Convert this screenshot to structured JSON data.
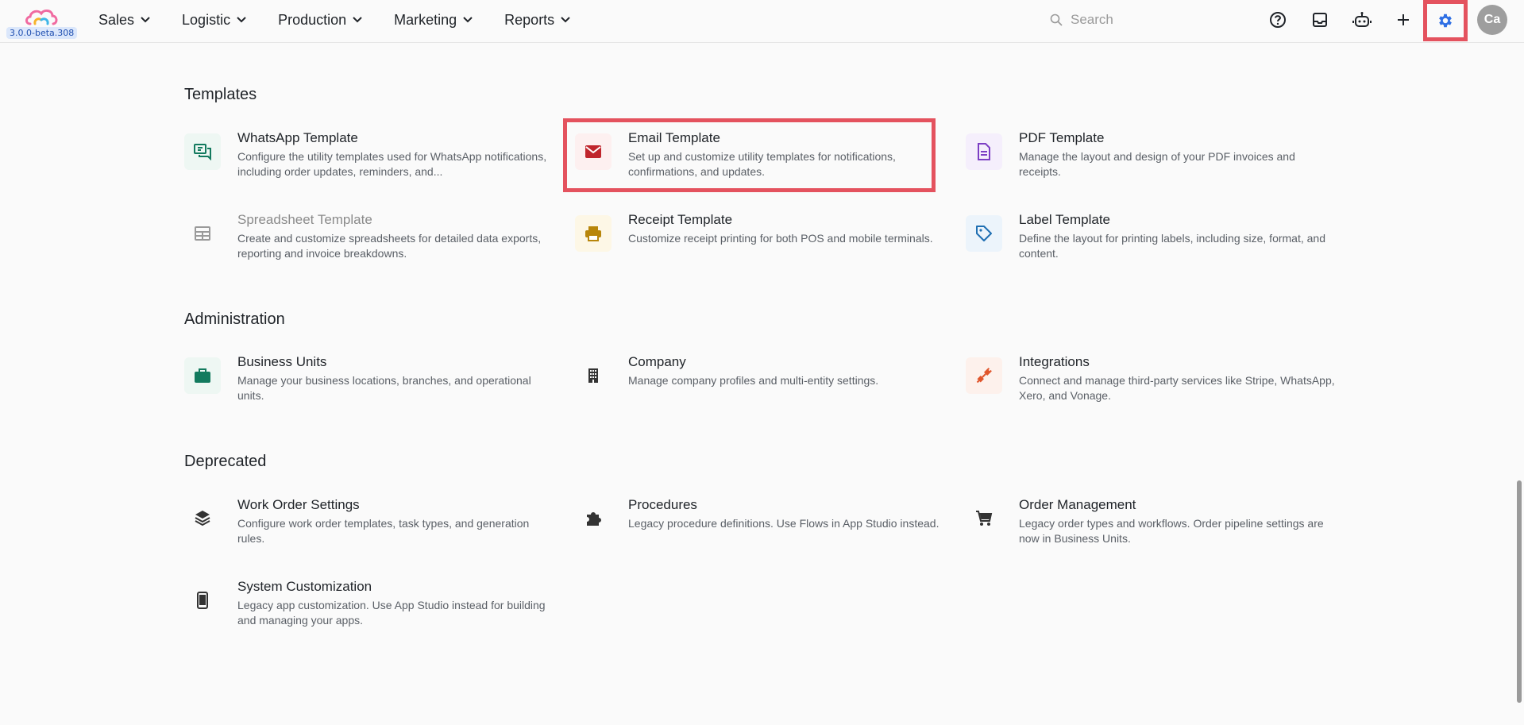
{
  "app": {
    "version": "3.0.0-beta.308"
  },
  "nav": [
    {
      "label": "Sales"
    },
    {
      "label": "Logistic"
    },
    {
      "label": "Production"
    },
    {
      "label": "Marketing"
    },
    {
      "label": "Reports"
    }
  ],
  "search": {
    "placeholder": "Search"
  },
  "user": {
    "initials": "Ca"
  },
  "sections": [
    {
      "title": "Templates",
      "cards": [
        {
          "title": "WhatsApp Template",
          "desc": "Configure the utility templates used for WhatsApp notifications, including order updates, reminders, and...",
          "icon": "chat-icon"
        },
        {
          "title": "Email Template",
          "desc": "Set up and customize utility templates for notifications, confirmations, and updates.",
          "icon": "mail-icon"
        },
        {
          "title": "PDF Template",
          "desc": "Manage the layout and design of your PDF invoices and receipts.",
          "icon": "document-icon"
        },
        {
          "title": "Spreadsheet Template",
          "desc": "Create and customize spreadsheets for detailed data exports, reporting and invoice breakdowns.",
          "icon": "table-icon"
        },
        {
          "title": "Receipt Template",
          "desc": "Customize receipt printing for both POS and mobile terminals.",
          "icon": "printer-icon"
        },
        {
          "title": "Label Template",
          "desc": "Define the layout for printing labels, including size, format, and content.",
          "icon": "tag-icon"
        }
      ]
    },
    {
      "title": "Administration",
      "cards": [
        {
          "title": "Business Units",
          "desc": "Manage your business locations, branches, and operational units.",
          "icon": "briefcase-icon"
        },
        {
          "title": "Company",
          "desc": "Manage company profiles and multi-entity settings.",
          "icon": "building-icon"
        },
        {
          "title": "Integrations",
          "desc": "Connect and manage third-party services like Stripe, WhatsApp, Xero, and Vonage.",
          "icon": "plug-icon"
        }
      ]
    },
    {
      "title": "Deprecated",
      "cards": [
        {
          "title": "Work Order Settings",
          "desc": "Configure work order templates, task types, and generation rules.",
          "icon": "layers-icon"
        },
        {
          "title": "Procedures",
          "desc": "Legacy procedure definitions. Use Flows in App Studio instead.",
          "icon": "puzzle-icon"
        },
        {
          "title": "Order Management",
          "desc": "Legacy order types and workflows. Order pipeline settings are now in Business Units.",
          "icon": "cart-icon"
        },
        {
          "title": "System Customization",
          "desc": "Legacy app customization. Use App Studio instead for building and managing your apps.",
          "icon": "phone-icon"
        }
      ]
    }
  ],
  "colors": {
    "accent": "#2f6fe4",
    "highlight": "#e4525e",
    "whatsapp": "#137a5e",
    "email": "#c0262d",
    "pdf": "#7c3fc4",
    "receipt": "#b8860b",
    "label": "#1f6fb2",
    "business": "#137a5e",
    "integrations": "#e0552b"
  }
}
